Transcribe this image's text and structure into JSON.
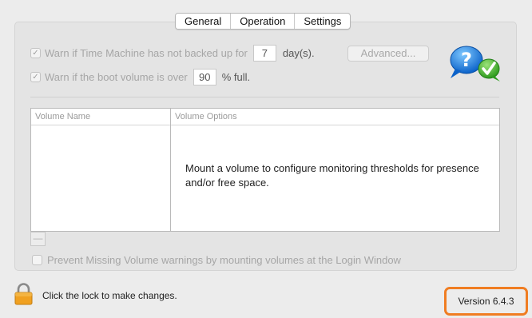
{
  "tabs": [
    {
      "label": "General"
    },
    {
      "label": "Operation"
    },
    {
      "label": "Settings"
    }
  ],
  "general": {
    "time_machine": {
      "checked": true,
      "label_before": "Warn if Time Machine has not backed up for",
      "value": "7",
      "label_after": "day(s)."
    },
    "boot_volume": {
      "checked": true,
      "label_before": "Warn if the boot volume is over",
      "value": "90",
      "label_after": "% full."
    },
    "advanced_button": "Advanced...",
    "table": {
      "columns": [
        "Volume Name",
        "Volume Options"
      ],
      "message": "Mount a volume to configure monitoring thresholds for presence and/or free space."
    },
    "remove_button": "—",
    "prevent_missing": {
      "checked": false,
      "label": "Prevent Missing Volume warnings by mounting volumes at the Login Window"
    }
  },
  "footer": {
    "lock_text": "Click the lock to make changes.",
    "version": "Version 6.4.3"
  },
  "icons": {
    "checkmark": "✓",
    "question": "?"
  },
  "colors": {
    "highlight": "#f07d22",
    "disabled_text": "#a6a6a6",
    "lock": "#f0a020"
  }
}
